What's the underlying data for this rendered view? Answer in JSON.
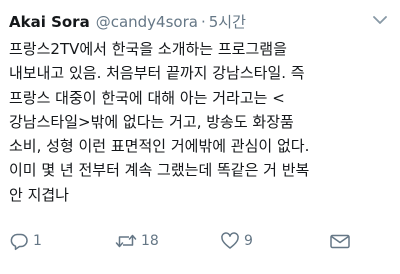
{
  "tweet": {
    "display_name": "Akai Sora",
    "handle": "@candy4sora",
    "separator": "·",
    "time": "5시간",
    "lines": [
      "프랑스2TV에서 한국을 소개하는 프로그램을",
      "내보내고 있음. 처음부터 끝까지 강남스타일. 즉",
      "프랑스 대중이 한국에 대해 아는 거라고는 <",
      "강남스타일>밖에 없다는 거고, 방송도 화장품",
      "소비, 성형 이런 표면적인 거에밖에 관심이 없다.",
      "이미 몇 년 전부터 계속 그랬는데 똑같은 거 반복",
      "안 지겹나"
    ]
  },
  "actions": {
    "reply_count": "1",
    "retweet_count": "18",
    "like_count": "9"
  },
  "icons": {
    "caret": "chevron-down-icon",
    "reply": "reply-icon",
    "retweet": "retweet-icon",
    "like": "heart-icon",
    "dm": "envelope-icon"
  },
  "colors": {
    "text": "#14171a",
    "muted": "#657786",
    "background": "#ffffff"
  }
}
